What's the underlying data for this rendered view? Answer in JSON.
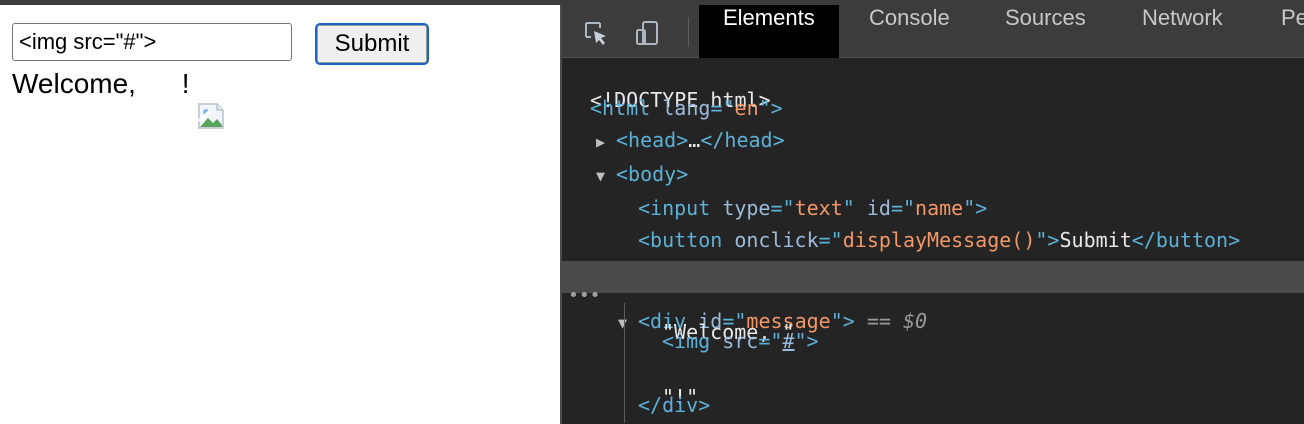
{
  "page": {
    "input_value": "<img src=\"#\">",
    "submit_label": "Submit",
    "message_prefix": "Welcome, ",
    "message_suffix": "!"
  },
  "devtools": {
    "tabs": [
      {
        "label": "Elements",
        "active": true
      },
      {
        "label": "Console",
        "active": false
      },
      {
        "label": "Sources",
        "active": false
      },
      {
        "label": "Network",
        "active": false
      },
      {
        "label": "Pe",
        "active": false
      }
    ],
    "icons": [
      "inspect-element-icon",
      "device-toolbar-icon"
    ],
    "dom": {
      "doctype": "<!DOCTYPE html>",
      "html_tag": "html",
      "html_attr_name": "lang",
      "html_attr_value": "en",
      "head_tag": "head",
      "head_ellipsis": "…",
      "body_tag": "body",
      "input_tag": "input",
      "input_attr1_name": "type",
      "input_attr1_value": "text",
      "input_attr2_name": "id",
      "input_attr2_value": "name",
      "button_tag": "button",
      "button_attr_name": "onclick",
      "button_attr_value": "displayMessage()",
      "button_text": "Submit",
      "div_tag": "div",
      "div_attr_name": "id",
      "div_attr_value": "message",
      "selected_marker": "== $0",
      "text_node_1": "\"Welcome, \"",
      "img_tag": "img",
      "img_attr_name": "src",
      "img_attr_value": "#",
      "text_node_2": "\"!\""
    }
  },
  "colors": {
    "tag": "#5db0d7",
    "attr_name": "#9bbbdc",
    "attr_value": "#f29766",
    "devtools_bg": "#242424",
    "selected_row": "#4a4a4a",
    "button_focus": "#1a64c8"
  }
}
